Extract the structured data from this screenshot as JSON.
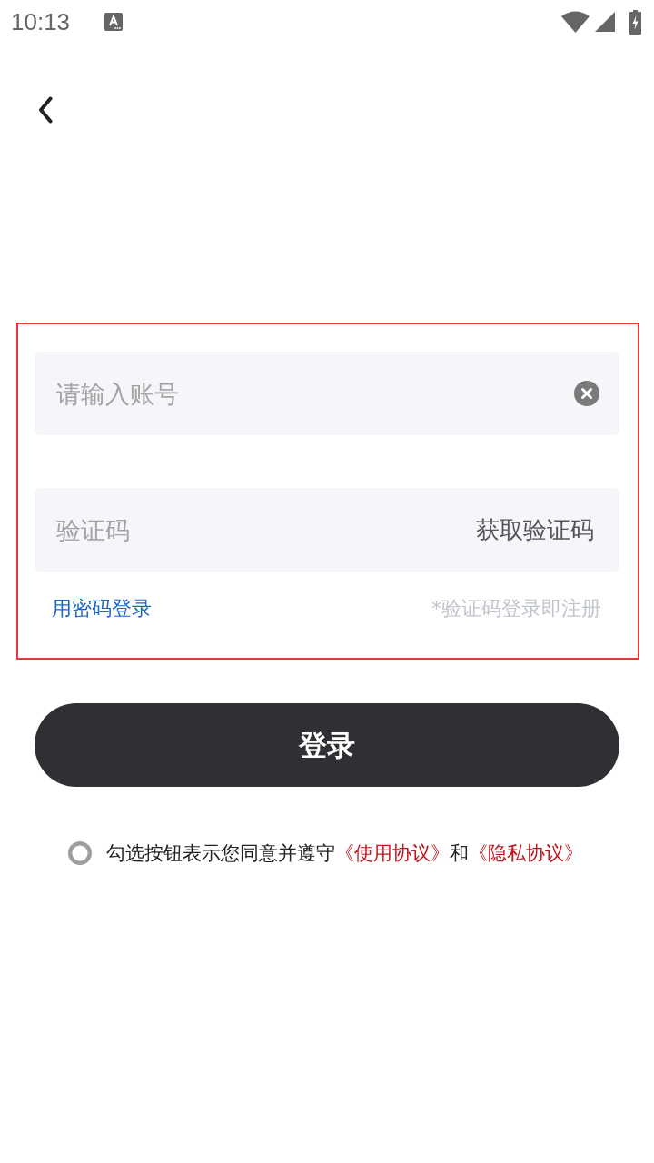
{
  "status_bar": {
    "time": "10:13"
  },
  "form": {
    "account_field": {
      "placeholder": "请输入账号"
    },
    "code_field": {
      "placeholder": "验证码",
      "action": "获取验证码"
    },
    "password_login_link": "用密码登录",
    "register_note": "*验证码登录即注册"
  },
  "login_button": "登录",
  "agreement": {
    "checked": false,
    "parts": [
      {
        "kind": "text",
        "text": "勾选按钮表示您同意并遵守"
      },
      {
        "kind": "link",
        "text": "《使用协议》"
      },
      {
        "kind": "text",
        "text": "和"
      },
      {
        "kind": "link",
        "text": "《隐私协议》"
      }
    ]
  }
}
